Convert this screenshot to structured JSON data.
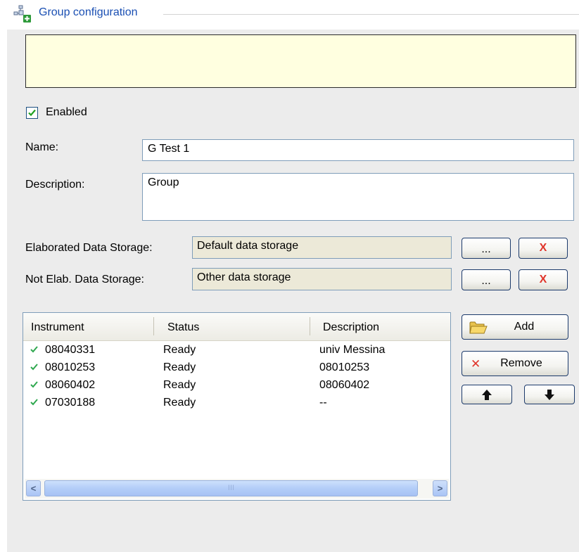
{
  "header": {
    "title": "Group configuration",
    "icon": "group-config-icon"
  },
  "info_box": {
    "text": ""
  },
  "enabled": {
    "label": "Enabled",
    "checked": true
  },
  "name": {
    "label": "Name:",
    "value": "G Test 1"
  },
  "description": {
    "label": "Description:",
    "value": "Group"
  },
  "elaborated_storage": {
    "label": "Elaborated Data Storage:",
    "value": "Default data storage",
    "browse_label": "...",
    "clear_label": "X"
  },
  "not_elaborated_storage": {
    "label": "Not Elab. Data Storage:",
    "value": "Other data storage",
    "browse_label": "...",
    "clear_label": "X"
  },
  "instruments": {
    "columns": [
      "Instrument",
      "Status",
      "Description"
    ],
    "rows": [
      {
        "instrument": "08040331",
        "status": "Ready",
        "description": "univ Messina"
      },
      {
        "instrument": "08010253",
        "status": "Ready",
        "description": "08010253"
      },
      {
        "instrument": "08060402",
        "status": "Ready",
        "description": "08060402"
      },
      {
        "instrument": "07030188",
        "status": "Ready",
        "description": "--"
      }
    ],
    "scrollbar": {
      "left": "<",
      "right": ">",
      "thumb": "III"
    }
  },
  "actions": {
    "add_label": "Add",
    "remove_label": "Remove",
    "up_label": "up",
    "down_label": "down"
  },
  "colors": {
    "header_title": "#1a4fb3",
    "info_bg": "#ffffe0",
    "check": "#2fa84f",
    "remove_x": "#e0352b"
  }
}
